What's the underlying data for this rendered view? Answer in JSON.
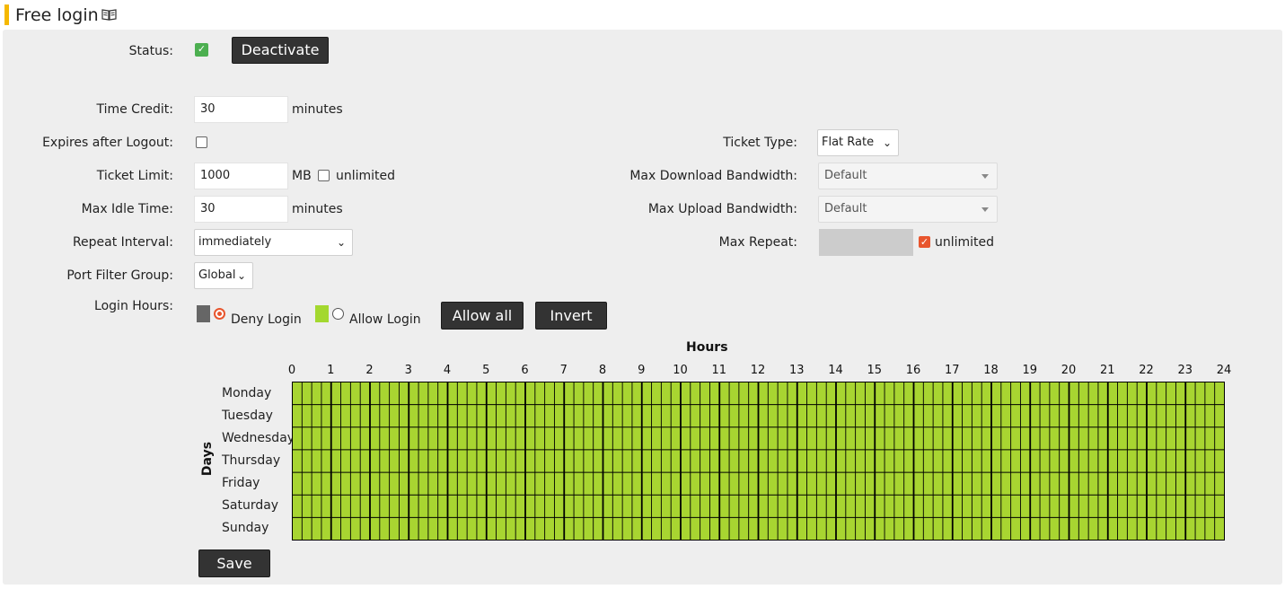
{
  "header": {
    "title": "Free login",
    "icon": "book-icon"
  },
  "status": {
    "label": "Status:",
    "checked": true,
    "deactivate_label": "Deactivate"
  },
  "time_credit": {
    "label": "Time Credit:",
    "value": "30",
    "unit": "minutes"
  },
  "expires_after_logout": {
    "label": "Expires after Logout:",
    "checked": false
  },
  "ticket_limit": {
    "label": "Ticket Limit:",
    "value": "1000",
    "unit": "MB",
    "unlimited_label": "unlimited",
    "unlimited_checked": false
  },
  "max_idle_time": {
    "label": "Max Idle Time:",
    "value": "30",
    "unit": "minutes"
  },
  "repeat_interval": {
    "label": "Repeat Interval:",
    "selected": "immediately"
  },
  "port_filter_group": {
    "label": "Port Filter Group:",
    "selected": "Global"
  },
  "ticket_type": {
    "label": "Ticket Type:",
    "selected": "Flat Rate"
  },
  "max_download_bandwidth": {
    "label": "Max Download Bandwidth:",
    "selected": "Default"
  },
  "max_upload_bandwidth": {
    "label": "Max Upload Bandwidth:",
    "selected": "Default"
  },
  "max_repeat": {
    "label": "Max Repeat:",
    "value": "",
    "unlimited_label": "unlimited",
    "unlimited_checked": true
  },
  "login_hours": {
    "label": "Login Hours:",
    "deny_label": "Deny Login",
    "allow_label": "Allow Login",
    "selected_mode": "deny",
    "allow_all_label": "Allow all",
    "invert_label": "Invert",
    "hours_title": "Hours",
    "days_title": "Days",
    "hours": [
      "0",
      "1",
      "2",
      "3",
      "4",
      "5",
      "6",
      "7",
      "8",
      "9",
      "10",
      "11",
      "12",
      "13",
      "14",
      "15",
      "16",
      "17",
      "18",
      "19",
      "20",
      "21",
      "22",
      "23",
      "24"
    ],
    "days": [
      "Monday",
      "Tuesday",
      "Wednesday",
      "Thursday",
      "Friday",
      "Saturday",
      "Sunday"
    ],
    "slots_per_hour": 4,
    "allowed_color": "#a8d531",
    "denied_color": "#666666",
    "all_allowed": true
  },
  "save_label": "Save"
}
